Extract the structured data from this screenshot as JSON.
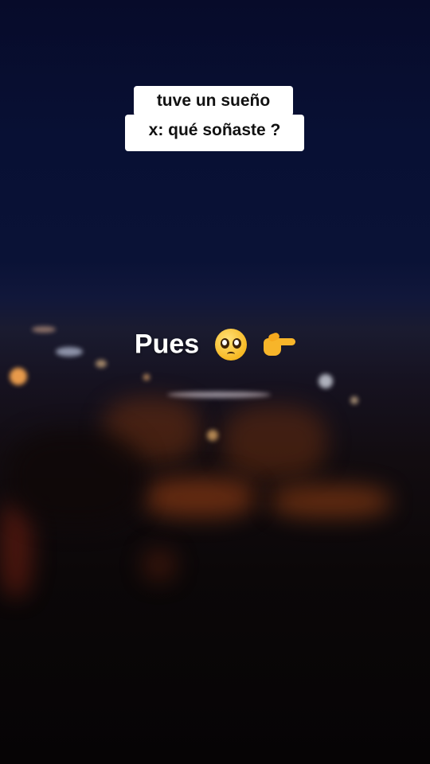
{
  "video": {
    "captions": {
      "line1": "tuve un sueño",
      "line2": "x: qué soñaste ?"
    },
    "overlay": {
      "text": "Pues",
      "emoji_1": "pleading-face-icon",
      "emoji_2": "backhand-index-pointing-right-icon"
    }
  },
  "colors": {
    "caption_bg": "#ffffff",
    "caption_text": "#111111",
    "overlay_text": "#ffffff",
    "night_sky": "#081034",
    "city_lights": "#f2a24a"
  }
}
